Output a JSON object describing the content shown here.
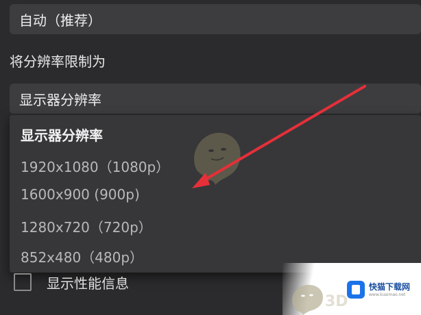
{
  "colors": {
    "background": "#2b2b2d",
    "select_bg": "#3d3d40",
    "dropdown_bg": "#37373a",
    "arrow": "#e5303a",
    "brand": "#1a73e8"
  },
  "top_select": {
    "value": "自动（推荐）"
  },
  "resolution_limit": {
    "label": "将分辨率限制为",
    "selected_value": "显示器分辨率",
    "options": [
      "显示器分辨率",
      "1920x1080（1080p）",
      "1600x900 (900p)",
      "1280x720（720p）",
      "852x480（480p）"
    ],
    "highlighted_index": 0
  },
  "performance_info": {
    "label": "显示性能信息",
    "checked": false
  },
  "watermark": {
    "brand_name": "快猫下载网",
    "brand_url": "www.kuaimao.net",
    "mascot_icon": "ghost-mascot-icon",
    "faint_text": "3D"
  }
}
